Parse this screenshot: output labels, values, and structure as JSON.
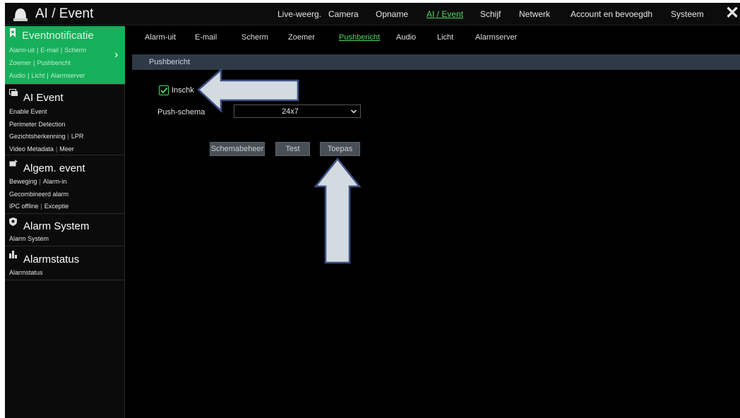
{
  "header": {
    "title": "AI / Event",
    "app_icon": "dome-camera-icon",
    "nav": [
      {
        "label": "Live-weerg.",
        "active": false
      },
      {
        "label": "Camera",
        "active": false
      },
      {
        "label": "Opname",
        "active": false
      },
      {
        "label": "AI / Event",
        "active": true
      },
      {
        "label": "Schijf",
        "active": false
      },
      {
        "label": "Netwerk",
        "active": false
      },
      {
        "label": "Account en bevoegdh",
        "active": false
      },
      {
        "label": "Systeem",
        "active": false
      }
    ],
    "close_icon": "close-icon"
  },
  "sidebar": {
    "groups": [
      {
        "title": "Eventnotificatie",
        "icon": "bookmark-star-icon",
        "active": true,
        "lines": [
          [
            "Alarm-uit",
            "E-mail",
            "Scherm"
          ],
          [
            "Zoemer",
            "Pushbericht"
          ],
          [
            "Audio",
            "Licht",
            "Alarmserver"
          ]
        ]
      },
      {
        "title": "AI Event",
        "icon": "ai-event-icon",
        "active": false,
        "lines": [
          [
            "Enable Event"
          ],
          [
            "Perimeter Detection"
          ],
          [
            "Gezichtsherkenning",
            "LPR"
          ],
          [
            "Video Metadata",
            "Meer"
          ]
        ]
      },
      {
        "title": "Algem. event",
        "icon": "general-event-icon",
        "active": false,
        "lines": [
          [
            "Beweging",
            "Alarm-in"
          ],
          [
            "Gecombineerd alarm"
          ],
          [
            "IPC offline",
            "Exceptie"
          ]
        ]
      },
      {
        "title": "Alarm System",
        "icon": "alarm-shield-icon",
        "active": false,
        "lines": [
          [
            "Alarm System"
          ]
        ]
      },
      {
        "title": "Alarmstatus",
        "icon": "bar-status-icon",
        "active": false,
        "lines": [
          [
            "Alarmstatus"
          ]
        ]
      }
    ]
  },
  "subtabs": [
    {
      "label": "Alarm-uit",
      "active": false
    },
    {
      "label": "E-mail",
      "active": false
    },
    {
      "label": "Scherm",
      "active": false
    },
    {
      "label": "Zoemer",
      "active": false
    },
    {
      "label": "Pushbericht",
      "active": true
    },
    {
      "label": "Audio",
      "active": false
    },
    {
      "label": "Licht",
      "active": false
    },
    {
      "label": "Alarmserver",
      "active": false
    }
  ],
  "section": {
    "title": "Pushbericht"
  },
  "form": {
    "enable_label": "Inschk",
    "enable_checked": true,
    "schedule_label": "Push-schema",
    "schedule_value": "24x7"
  },
  "buttons": {
    "schedule": "Schemabeheer",
    "test": "Test",
    "apply": "Toepas"
  },
  "colors": {
    "accent_green": "#4cd964",
    "sidebar_active": "#16b05a",
    "section_header": "#2e3a45",
    "button_bg": "#4a4f55",
    "arrow_fill": "#d3dbe0",
    "arrow_stroke": "#3d4f82"
  }
}
